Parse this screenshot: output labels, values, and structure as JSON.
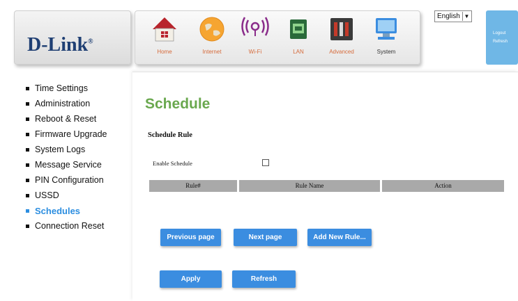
{
  "header": {
    "logo": "D-Link",
    "logo_mark": "®",
    "nav": [
      {
        "label": "Home",
        "icon": "home-icon"
      },
      {
        "label": "Internet",
        "icon": "globe-icon"
      },
      {
        "label": "Wi-Fi",
        "icon": "wifi-icon"
      },
      {
        "label": "LAN",
        "icon": "lan-icon"
      },
      {
        "label": "Advanced",
        "icon": "tools-icon"
      },
      {
        "label": "System",
        "icon": "computer-icon"
      }
    ],
    "language": "English",
    "logout": "Logout",
    "refresh": "Refresh"
  },
  "sidebar": {
    "items": [
      {
        "label": "Time Settings"
      },
      {
        "label": "Administration"
      },
      {
        "label": "Reboot & Reset"
      },
      {
        "label": "Firmware Upgrade"
      },
      {
        "label": "System Logs"
      },
      {
        "label": "Message Service"
      },
      {
        "label": "PIN Configuration"
      },
      {
        "label": "USSD"
      },
      {
        "label": "Schedules"
      },
      {
        "label": "Connection Reset"
      }
    ],
    "active": "Schedules"
  },
  "main": {
    "title": "Schedule",
    "section": "Schedule Rule",
    "enable_label": "Enable Schedule",
    "enable_checked": false,
    "table_columns": [
      "Rule#",
      "Rule Name",
      "Action"
    ],
    "buttons": {
      "previous": "Previous page",
      "next": "Next page",
      "add": "Add New Rule...",
      "apply": "Apply",
      "refresh": "Refresh"
    }
  },
  "colors": {
    "title_green": "#6aa84f",
    "active_blue": "#2c8ee0",
    "button_blue": "#3b8de0",
    "header_bar_gray": "#a9a9a9",
    "logo_navy": "#1f3f73"
  }
}
